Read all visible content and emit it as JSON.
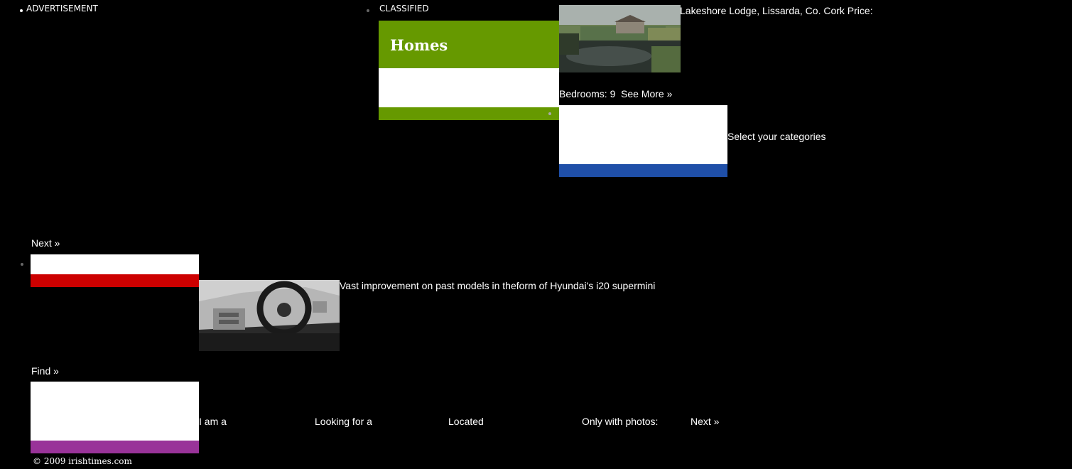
{
  "top": {
    "advertisement_label": "ADVERTISEMENT",
    "classified_label": "CLASSIFIED"
  },
  "homes": {
    "title": "Homes",
    "accent_color": "#669900",
    "listing_text": "Lakeshore Lodge, Lissarda, Co. Cork Price:",
    "bedrooms_text": "Bedrooms: 9",
    "see_more_label": "See More »",
    "next_label": "Next »"
  },
  "categories": {
    "accent_color": "#1f4fa8",
    "select_label": "Select your categories"
  },
  "motors": {
    "accent_color": "#cc0000",
    "article_text": "Vast improvement on past models in theform of Hyundai's i20 supermini",
    "find_label": "Find »"
  },
  "dating": {
    "accent_color": "#993399",
    "i_am_label": "I am a",
    "looking_for_label": "Looking for a",
    "located_label": "Located",
    "photos_label": "Only with photos:",
    "next_label": "Next »"
  },
  "footer": {
    "copyright": "© 2009 irishtimes.com"
  }
}
